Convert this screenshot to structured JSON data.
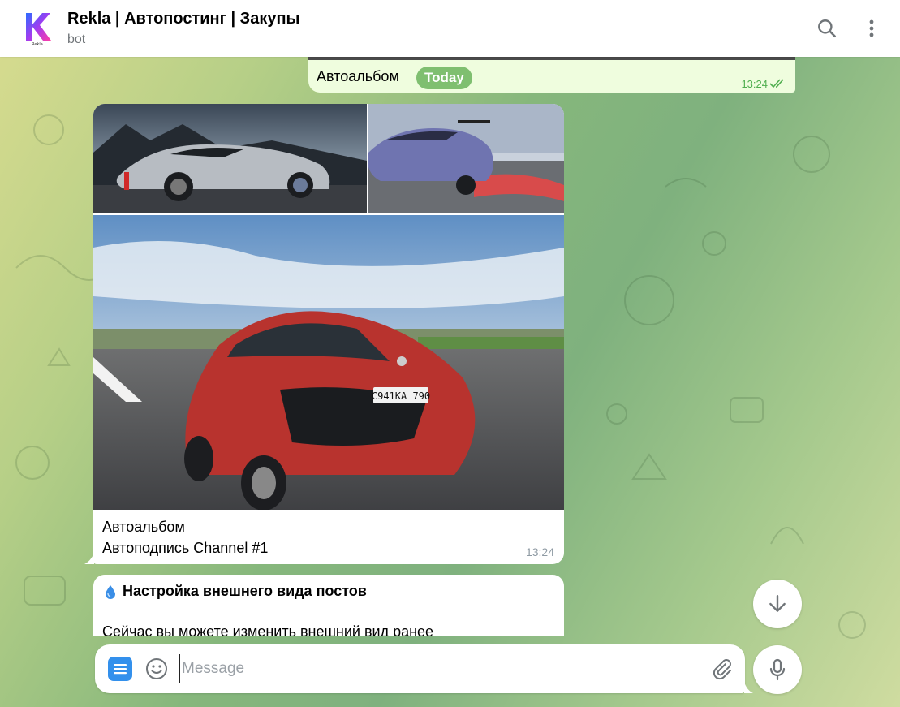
{
  "header": {
    "title": "Rekla | Автопостинг | Закупы",
    "subtitle": "bot",
    "avatar_label": "Rekla"
  },
  "outgoing": {
    "text": "Автоальбом",
    "badge": "Today",
    "time": "13:24"
  },
  "album": {
    "caption_line1": "Автоальбом",
    "caption_line2": "Автоподпись Channel #1",
    "time": "13:24",
    "plate": "С941КА 790"
  },
  "settings_message": {
    "title": "Настройка внешнего вида постов",
    "body": "Сейчас вы можете изменить внешний вид ранее"
  },
  "composer": {
    "placeholder": "Message"
  },
  "colors": {
    "accent": "#3390ec",
    "outgoing_bubble": "#effdde",
    "today_badge": "#7fbf70",
    "read_check": "#4fae4e"
  }
}
